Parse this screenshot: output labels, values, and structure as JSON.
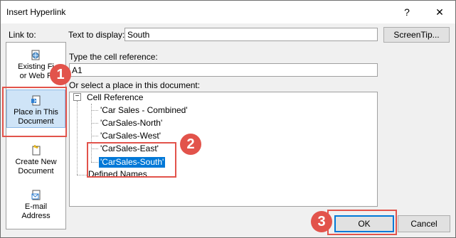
{
  "window": {
    "title": "Insert Hyperlink",
    "help_glyph": "?",
    "close_glyph": "✕"
  },
  "left": {
    "label": "Link to:",
    "items": [
      {
        "label": "Existing File or Web Page",
        "line1": "Existing Fi",
        "line2": "or Web P",
        "icon": "globe-document-icon"
      },
      {
        "label": "Place in This Document",
        "line1": "Place in This",
        "line2": "Document",
        "icon": "document-icon"
      },
      {
        "label": "Create New Document",
        "line1": "Create New",
        "line2": "Document",
        "icon": "new-document-icon"
      },
      {
        "label": "E-mail Address",
        "line1": "E-mail",
        "line2": "Address",
        "icon": "email-icon"
      }
    ]
  },
  "form": {
    "text_to_display_label": "Text to display:",
    "text_to_display_value": "South",
    "screentip_label": "ScreenTip...",
    "cell_ref_label": "Type the cell reference:",
    "cell_ref_value": "A1",
    "place_label": "Or select a place in this document:"
  },
  "tree": {
    "root": "Cell Reference",
    "root_toggle": "−",
    "sheets": [
      "'Car Sales - Combined'",
      "'CarSales-North'",
      "'CarSales-West'",
      "'CarSales-East'",
      "'CarSales-South'"
    ],
    "selected_index": 4,
    "defined_names": "Defined Names"
  },
  "buttons": {
    "ok": "OK",
    "cancel": "Cancel"
  },
  "callouts": {
    "one": "1",
    "two": "2",
    "three": "3"
  },
  "colors": {
    "highlight": "#e2534b",
    "selection": "#0078d7",
    "nav_selected": "#cfe4f7"
  }
}
